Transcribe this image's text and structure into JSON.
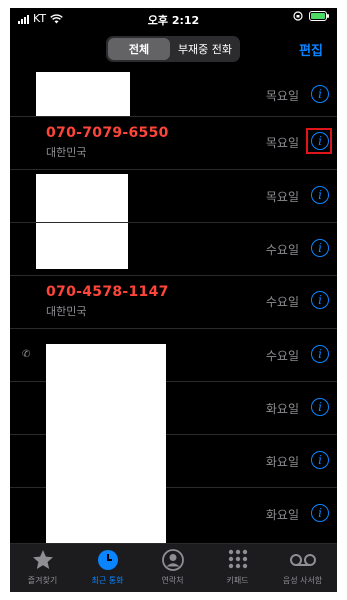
{
  "status_bar": {
    "carrier": "KT",
    "time": "오후 2:12"
  },
  "header": {
    "segment_all": "전체",
    "segment_missed": "부재중 전화",
    "edit": "편집"
  },
  "calls": [
    {
      "name": "",
      "sub": "",
      "day": "목요일"
    },
    {
      "name": "070-7079-6550",
      "sub": "대한민국",
      "day": "목요일"
    },
    {
      "name": "",
      "sub": "",
      "day": "목요일"
    },
    {
      "name": "",
      "sub": "",
      "day": "수요일"
    },
    {
      "name": "070-4578-1147",
      "sub": "대한민국",
      "day": "수요일"
    },
    {
      "name": "",
      "sub": "",
      "day": "수요일"
    },
    {
      "name": "",
      "sub": "",
      "day": "화요일"
    },
    {
      "name": "",
      "sub": "",
      "day": "화요일"
    },
    {
      "name": "",
      "sub": "",
      "day": "화요일"
    }
  ],
  "tabs": [
    {
      "label": "즐겨찾기",
      "icon": "star-icon"
    },
    {
      "label": "최근 통화",
      "icon": "clock-icon",
      "active": true
    },
    {
      "label": "연락처",
      "icon": "contact-icon"
    },
    {
      "label": "키패드",
      "icon": "keypad-icon"
    },
    {
      "label": "음성 사서함",
      "icon": "voicemail-icon"
    }
  ],
  "colors": {
    "accent": "#0a84ff",
    "missed": "#ff453a",
    "highlight": "#e0151b"
  }
}
